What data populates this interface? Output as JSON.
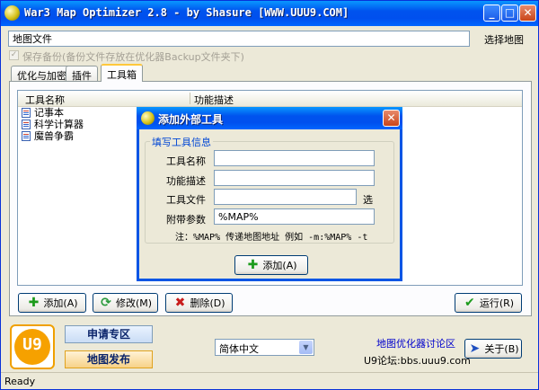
{
  "window": {
    "title": "War3 Map Optimizer 2.8 - by Shasure [WWW.UUU9.COM]",
    "minimize": "_",
    "maximize": "□",
    "close": "✕"
  },
  "map_file": {
    "value": "地图文件",
    "select_label": "选择地图"
  },
  "backup": {
    "label": "保存备份(备份文件存放在优化器Backup文件夹下)",
    "checked": true
  },
  "tabs": [
    {
      "label": "优化与加密",
      "active": false
    },
    {
      "label": "插件",
      "active": false
    },
    {
      "label": "工具箱",
      "active": true
    }
  ],
  "tool_list": {
    "columns": [
      "工具名称",
      "功能描述"
    ],
    "rows": [
      {
        "name": "记事本",
        "icon": "notepad-icon"
      },
      {
        "name": "科学计算器",
        "icon": "calculator-icon"
      },
      {
        "name": "魔兽争霸",
        "icon": "warcraft-icon"
      }
    ]
  },
  "actions": {
    "add": "添加(A)",
    "edit": "修改(M)",
    "delete": "删除(D)",
    "run": "运行(R)"
  },
  "bottom": {
    "logo_text": "U9",
    "apply_zone": "申请专区",
    "map_publish": "地图发布",
    "language": "简体中文",
    "forum_link": "地图优化器讨论区",
    "forum_url": "U9论坛:bbs.uuu9.com",
    "about": "关于(B)"
  },
  "status": "Ready",
  "dialog": {
    "title": "添加外部工具",
    "group_label": "填写工具信息",
    "fields": {
      "name_label": "工具名称",
      "name_value": "",
      "desc_label": "功能描述",
      "desc_value": "",
      "file_label": "工具文件",
      "file_value": "",
      "file_select": "选",
      "args_label": "附带参数",
      "args_value": "%MAP%"
    },
    "note": "注：%MAP% 传递地图地址 例如 -m:%MAP% -t",
    "add_button": "添加(A)"
  }
}
